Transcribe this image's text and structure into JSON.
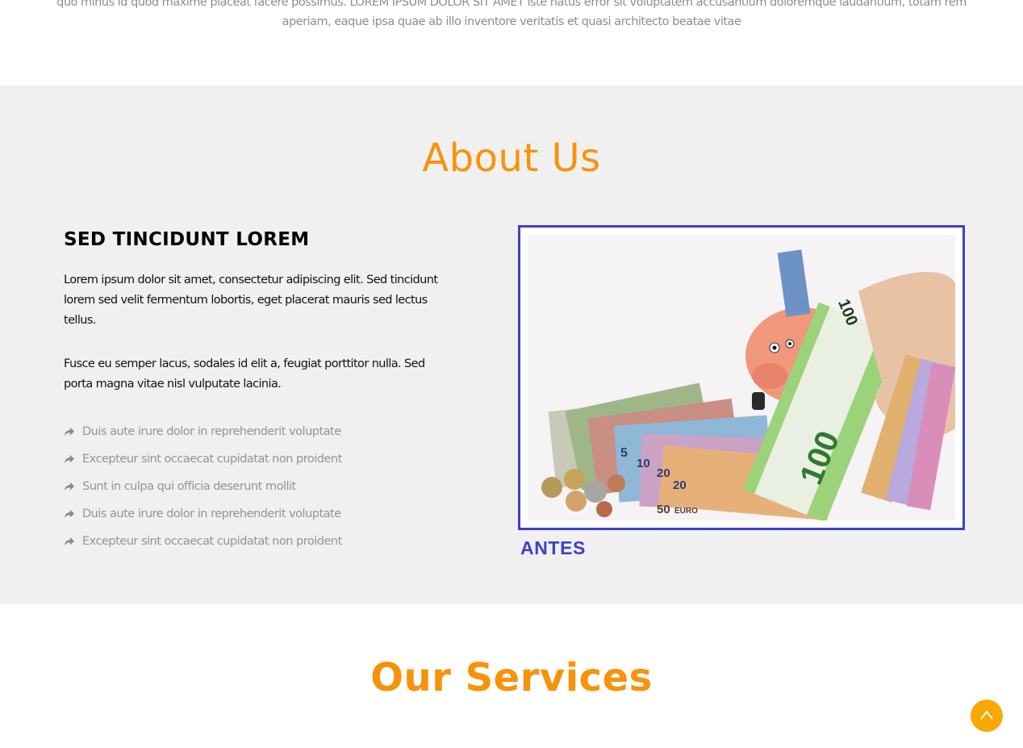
{
  "intro": {
    "text": "quo minus id quod maxime placeat facere possimus. LOREM IPSUM DOLOR SIT AMET iste natus error sit voluptatem accusantium doloremque laudantium, totam rem aperiam, eaque ipsa quae ab illo inventore veritatis et quasi architecto beatae vitae"
  },
  "about": {
    "title": "About Us",
    "heading": "SED TINCIDUNT LOREM",
    "paragraphs": [
      "Lorem ipsum dolor sit amet, consectetur adipiscing elit. Sed tincidunt lorem sed velit fermentum lobortis, eget placerat mauris sed lectus tellus.",
      "Fusce eu semper lacus, sodales id elit a, feugiat porttitor nulla. Sed porta magna vitae nisl vulputate lacinia."
    ],
    "list": [
      "Duis aute irure dolor in reprehenderit voluptate",
      "Excepteur sint occaecat cupidatat non proident",
      "Sunt in culpa qui officia deserunt mollit",
      "Duis aute irure dolor in reprehenderit voluptate",
      "Excepteur sint occaecat cupidatat non proident"
    ],
    "image_caption": "ANTES",
    "banknote_labels": {
      "note_100": "100",
      "euro": "EURO",
      "note_50": "50",
      "note_20": "20",
      "note_10": "10",
      "note_5": "5"
    }
  },
  "services": {
    "title": "Our Services"
  },
  "icons": {
    "list_bullet": "share-arrow-icon",
    "back_to_top": "chevron-up-icon"
  },
  "colors": {
    "accent": "#f7930a",
    "frame": "#3f40c5",
    "section_bg": "#f0f0f0",
    "back_to_top": "#f9a800"
  }
}
